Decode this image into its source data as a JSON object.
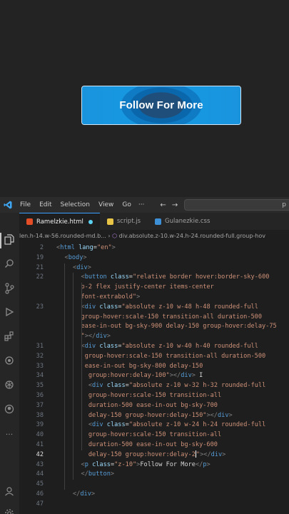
{
  "preview": {
    "button_label": "Follow For More"
  },
  "titlebar": {
    "menus": [
      "File",
      "Edit",
      "Selection",
      "View",
      "Go"
    ],
    "more": "···",
    "back_arrow": "←",
    "forward_arrow": "→",
    "search_hint": "p"
  },
  "tabs": [
    {
      "label": "Ramelzkie.html",
      "icon_color": "#e44d26"
    },
    {
      "label": "script.js",
      "icon_color": "#e8c547"
    },
    {
      "label": "Gulanezkie.css",
      "icon_color": "#3d8fd6"
    }
  ],
  "breadcrumb": {
    "left": "len.h-14.w-56.rounded-md.b...",
    "sep": "›",
    "right": "div.absolute.z-10.w-24.h-24.rounded-full.group-hov"
  },
  "editor": {
    "lines": [
      {
        "n": "2",
        "html": "<span class=\"t\">&lt;</span><span class=\"tag\">html</span> <span class=\"at\">lang</span>=<span class=\"str\">\"en\"</span><span class=\"t\">&gt;</span>",
        "indent": 0
      },
      {
        "n": "19",
        "html": "<span class=\"t\">&lt;</span><span class=\"tag\">body</span><span class=\"t\">&gt;</span>",
        "indent": 1
      },
      {
        "n": "21",
        "html": "<span class=\"t\">&lt;</span><span class=\"tag\">div</span><span class=\"t\">&gt;</span>",
        "indent": 2
      },
      {
        "n": "22",
        "html": "<span class=\"t\">&lt;</span><span class=\"tag\">button</span> <span class=\"at\">class</span>=<span class=\"str\">\"relative border hover:border-sky-600</span>",
        "indent": 3
      },
      {
        "n": "",
        "html": "<span class=\"str\">p-2 flex justify-center items-center</span>",
        "indent": 3
      },
      {
        "n": "",
        "html": "<span class=\"str\">font-extrabold\"</span><span class=\"t\">&gt;</span>",
        "indent": 3
      },
      {
        "n": "23",
        "html": "<span class=\"t\">&lt;</span><span class=\"tag\">div</span> <span class=\"at\">class</span>=<span class=\"str\">\"absolute z-10 w-48 h-48 rounded-full</span>",
        "indent": 3
      },
      {
        "n": "",
        "html": "<span class=\"str\">group-hover:scale-150 transition-all duration-500</span>",
        "indent": 3
      },
      {
        "n": "",
        "html": "<span class=\"str\">ease-in-out bg-sky-900 delay-150 group-hover:delay-75</span>",
        "indent": 3
      },
      {
        "n": "",
        "html": "<span class=\"str\">\"</span><span class=\"t\">&gt;&lt;/</span><span class=\"tag\">div</span><span class=\"t\">&gt;</span>",
        "indent": 3
      },
      {
        "n": "31",
        "html": "<span class=\"t\">&lt;</span><span class=\"tag\">div</span> <span class=\"at\">class</span>=<span class=\"str\">\"absolute z-10 w-40 h-40 rounded-full</span>",
        "indent": 3
      },
      {
        "n": "32",
        "html": " <span class=\"str\">group-hover:scale-150 transition-all duration-500</span>",
        "indent": 3
      },
      {
        "n": "33",
        "html": " <span class=\"str\">ease-in-out bg-sky-800 delay-150</span>",
        "indent": 3
      },
      {
        "n": "34",
        "html": "  <span class=\"str\">group:hover:delay-100\"</span><span class=\"t\">&gt;&lt;/</span><span class=\"tag\">div</span><span class=\"t\">&gt;</span> <span class=\"tx\">I</span>",
        "indent": 3
      },
      {
        "n": "35",
        "html": "  <span class=\"t\">&lt;</span><span class=\"tag\">div</span> <span class=\"at\">class</span>=<span class=\"str\">\"absolute z-10 w-32 h-32 rounded-full</span>",
        "indent": 3
      },
      {
        "n": "36",
        "html": "  <span class=\"str\">group-hover:scale-150 transition-all</span>",
        "indent": 3
      },
      {
        "n": "37",
        "html": "  <span class=\"str\">duration-500 ease-in-out bg-sky-700</span>",
        "indent": 3
      },
      {
        "n": "38",
        "html": "  <span class=\"str\">delay-150 group-hover:delay-150\"</span><span class=\"t\">&gt;&lt;/</span><span class=\"tag\">div</span><span class=\"t\">&gt;</span>",
        "indent": 3
      },
      {
        "n": "39",
        "html": "  <span class=\"t\">&lt;</span><span class=\"tag\">div</span> <span class=\"at\">class</span>=<span class=\"str\">\"absolute z-10 w-24 h-24 rounded-full</span>",
        "indent": 3
      },
      {
        "n": "40",
        "html": "  <span class=\"str\">group-hover:scale-150 transition-all</span>",
        "indent": 3
      },
      {
        "n": "41",
        "html": "  <span class=\"str\">duration-500 ease-in-out bg-sky-600</span>",
        "indent": 3
      },
      {
        "n": "42",
        "html": "  <span class=\"str\">delay-150 group:hover:delay-2</span><span class=\"cursor\"></span><span class=\"str\">\"</span><span class=\"t\">&gt;&lt;/</span><span class=\"tag\">div</span><span class=\"t\">&gt;</span>",
        "indent": 3,
        "current": true
      },
      {
        "n": "43",
        "html": "<span class=\"t\">&lt;</span><span class=\"tag\">p</span> <span class=\"at\">class</span>=<span class=\"str\">\"z-10\"</span><span class=\"t\">&gt;</span><span class=\"tx\">Follow For More</span><span class=\"t\">&lt;/</span><span class=\"tag\">p</span><span class=\"t\">&gt;</span>",
        "indent": 3
      },
      {
        "n": "44",
        "html": "<span class=\"t\">&lt;/</span><span class=\"tag\">button</span><span class=\"t\">&gt;</span>",
        "indent": 3
      },
      {
        "n": "45",
        "html": "",
        "indent": 0
      },
      {
        "n": "46",
        "html": "<span class=\"t\">&lt;/</span><span class=\"tag\">div</span><span class=\"t\">&gt;</span>",
        "indent": 2
      },
      {
        "n": "47",
        "html": "",
        "indent": 0
      }
    ]
  }
}
